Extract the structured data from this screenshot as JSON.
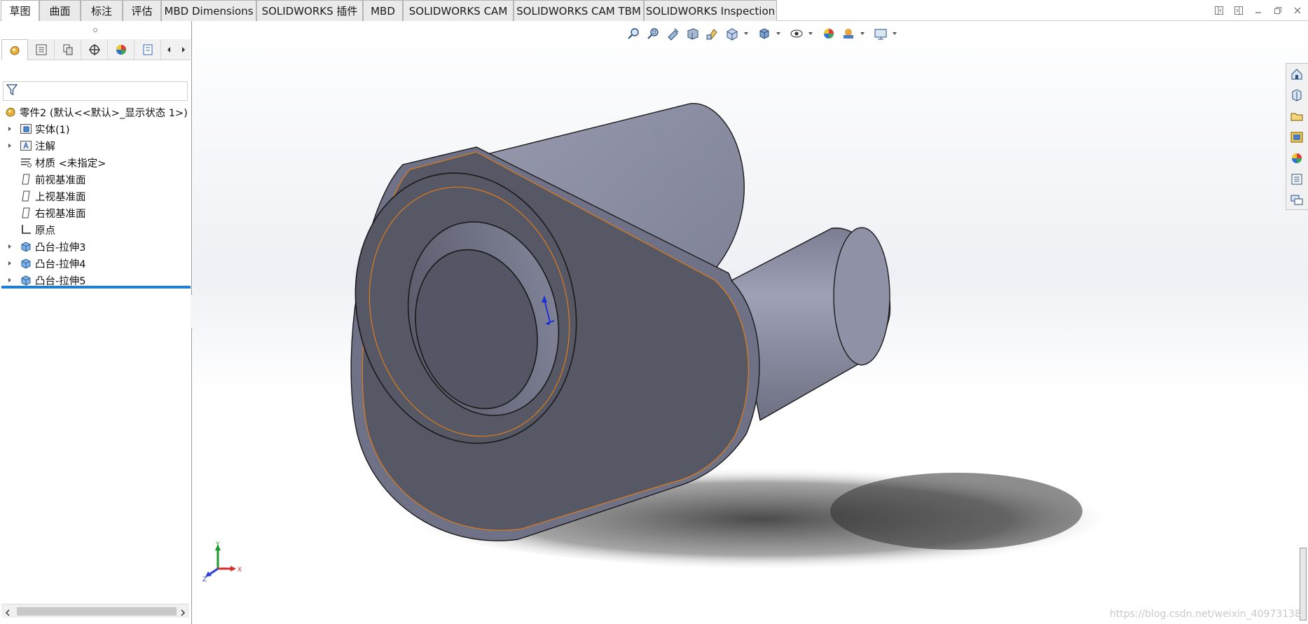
{
  "tabs": [
    {
      "label": "草图",
      "active": true
    },
    {
      "label": "曲面",
      "active": false
    },
    {
      "label": "标注",
      "active": false
    },
    {
      "label": "评估",
      "active": false
    },
    {
      "label": "MBD Dimensions",
      "active": false
    },
    {
      "label": "SOLIDWORKS 插件",
      "active": false
    },
    {
      "label": "MBD",
      "active": false
    },
    {
      "label": "SOLIDWORKS CAM",
      "active": false
    },
    {
      "label": "SOLIDWORKS CAM TBM",
      "active": false
    },
    {
      "label": "SOLIDWORKS Inspection",
      "active": false
    }
  ],
  "tree": {
    "root": "零件2  (默认<<默认>_显示状态 1>)",
    "items": [
      {
        "label": "实体(1)",
        "icon": "solid-bodies-folder-icon",
        "expandable": true
      },
      {
        "label": "注解",
        "icon": "annotations-folder-icon",
        "expandable": true
      },
      {
        "label": "材质 <未指定>",
        "icon": "material-icon",
        "expandable": false
      },
      {
        "label": "前视基准面",
        "icon": "plane-icon",
        "expandable": false
      },
      {
        "label": "上视基准面",
        "icon": "plane-icon",
        "expandable": false
      },
      {
        "label": "右视基准面",
        "icon": "plane-icon",
        "expandable": false
      },
      {
        "label": "原点",
        "icon": "origin-icon",
        "expandable": false
      },
      {
        "label": "凸台-拉伸3",
        "icon": "boss-extrude-icon",
        "expandable": true
      },
      {
        "label": "凸台-拉伸4",
        "icon": "boss-extrude-icon",
        "expandable": true
      },
      {
        "label": "凸台-拉伸5",
        "icon": "boss-extrude-icon",
        "expandable": true
      }
    ]
  },
  "triad": {
    "x": "X",
    "y": "Y",
    "z": "Z"
  },
  "watermark": "https://blog.csdn.net/weixin_40973138",
  "colors": {
    "accent": "#1e7fd4",
    "model_face": "#565866",
    "edge_highlight": "#e07b18"
  }
}
